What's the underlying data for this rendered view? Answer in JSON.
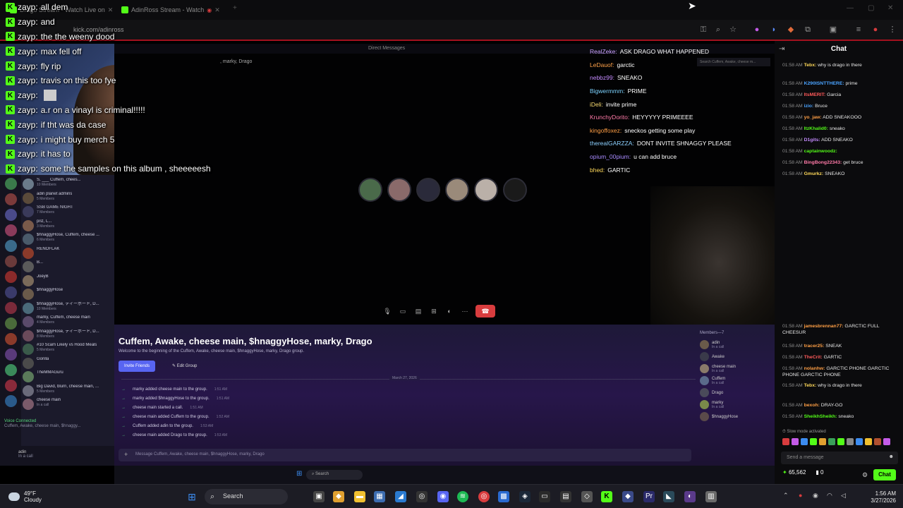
{
  "browser": {
    "tabs": [
      {
        "label": "Drago Stream - Watch Live on"
      },
      {
        "label": "AdinRoss Stream - Watch"
      }
    ],
    "url": "kick.com/adinross"
  },
  "overlay_chat": [
    {
      "user": "zayp:",
      "text": "all dem"
    },
    {
      "user": "zayp:",
      "text": "and"
    },
    {
      "user": "zayp:",
      "text": "the the weeny dood"
    },
    {
      "user": "zayp:",
      "text": "max fell off"
    },
    {
      "user": "zayp:",
      "text": "fly rip"
    },
    {
      "user": "zayp:",
      "text": "travis on this too fye"
    },
    {
      "user": "zayp:",
      "text": ""
    },
    {
      "user": "zayp:",
      "text": "a.r on a vinayl is criminal!!!!!"
    },
    {
      "user": "zayp:",
      "text": "if tht was da case"
    },
    {
      "user": "zayp:",
      "text": "i might buy merch 5"
    },
    {
      "user": "zayp:",
      "text": "it has to"
    },
    {
      "user": "zayp:",
      "text": "some the samples on this album , sheeeeesh"
    }
  ],
  "discord": {
    "topbar": "Direct Messages",
    "call_title": ", marky, Drago",
    "search_placeholder": "Search Cuffem, Awake, cheese m...",
    "dm_list": [
      {
        "name": "S, ___ Cuffem, chees...",
        "sub": "10 Members"
      },
      {
        "name": "adin planet admins",
        "sub": "5 Members"
      },
      {
        "name": "SSB GAME NIGHT",
        "sub": "7 Members"
      },
      {
        "name": "priz, L...",
        "sub": "3 Members"
      },
      {
        "name": "$hnaggyHose, Cuffem, cheese ...",
        "sub": "6 Members"
      },
      {
        "name": "RENOFLAK",
        "sub": ""
      },
      {
        "name": "B...",
        "sub": ""
      },
      {
        "name": "JoeyB",
        "sub": ""
      },
      {
        "name": "$hnaggyHose",
        "sub": ""
      },
      {
        "name": "$hnaggyHose, ディーボード, D...",
        "sub": "10 Members"
      },
      {
        "name": "marky, Cuffem, cheese main",
        "sub": "4 Members"
      },
      {
        "name": "$hnaggyHose, ディーボード, D...",
        "sub": "8 Members"
      },
      {
        "name": "#10 Scam Likely vs Hood Meals",
        "sub": "5 Members"
      },
      {
        "name": "Gorilla",
        "sub": ""
      },
      {
        "name": "TheMMAGuru",
        "sub": ""
      },
      {
        "name": "Big David, blurri, cheese main, ...",
        "sub": "5 Members"
      },
      {
        "name": "cheese main",
        "sub": "In a call"
      }
    ],
    "voice_status": "Voice Connected",
    "voice_channel": "Cuffem, Awake, cheese main, $hnaggy...",
    "user_name": "adin",
    "user_status": "In a call",
    "group_title": "Cuffem, Awake, cheese main, $hnaggyHose, marky, Drago",
    "group_sub": "Welcome to the beginning of the Cuffem, Awake, cheese main, $hnaggyHose, marky, Drago group.",
    "invite_btn": "Invite Friends",
    "edit_btn": "Edit Group",
    "date_divider": "March 27, 2026",
    "system_messages": [
      {
        "text": "marky added cheese main to the group.",
        "ts": "1:51 AM"
      },
      {
        "text": "marky added $hnaggyHose to the group.",
        "ts": "1:51 AM"
      },
      {
        "text": "cheese main started a call.",
        "ts": "1:51 AM"
      },
      {
        "text": "cheese main added Cuffem to the group.",
        "ts": "1:52 AM"
      },
      {
        "text": "Cuffem added adin to the group.",
        "ts": "1:53 AM"
      },
      {
        "text": "cheese main added Drago to the group.",
        "ts": "1:53 AM"
      }
    ],
    "members_header": "Members—7",
    "members": [
      {
        "name": "adin",
        "sub": "In a call"
      },
      {
        "name": "Awake",
        "sub": ""
      },
      {
        "name": "cheese main",
        "sub": "In a call"
      },
      {
        "name": "Cuffem",
        "sub": "In a call"
      },
      {
        "name": "Drago",
        "sub": ""
      },
      {
        "name": "marky",
        "sub": "In a call"
      },
      {
        "name": "$hnaggyHose",
        "sub": ""
      }
    ],
    "message_placeholder": "Message Cuffem, Awake, cheese main, $hnaggyHose, marky, Drago"
  },
  "game_chat": [
    {
      "user": "RealZeke:",
      "text": "ASK DRAGO WHAT HAPPENED",
      "color": "#c9a0ff"
    },
    {
      "user": "LeDauof:",
      "text": "garctic",
      "color": "#ffa24a"
    },
    {
      "user": "nebbz99:",
      "text": "SNEAKO",
      "color": "#c58bff"
    },
    {
      "user": "Bigwermmm:",
      "text": "PRIME",
      "color": "#7dd3ff"
    },
    {
      "user": "iDeli:",
      "text": "invite prime",
      "color": "#f5d76e"
    },
    {
      "user": "KrunchyDorito:",
      "text": "HEYYYYY PRIMEEEE",
      "color": "#ff7aa8"
    },
    {
      "user": "kingoffoxez:",
      "text": "sneckos getting some play",
      "color": "#ff9f45"
    },
    {
      "user": "therealGARZZA:",
      "text": "DONT INVITE SHNAGGY PLEASE",
      "color": "#8cd0ff"
    },
    {
      "user": "opium_00pium:",
      "text": "u can add bruce",
      "color": "#a88bff"
    },
    {
      "user": "bhed:",
      "text": "GARTIC",
      "color": "#ffd95a"
    }
  ],
  "kick_chat": {
    "title": "Chat",
    "messages": [
      {
        "time": "01:58 AM",
        "user": "Tebx:",
        "text": "why is drago in there",
        "color": "#ffd95a"
      },
      {
        "time": "01:58 AM",
        "user": "K290ISNTTHERE:",
        "text": "prime",
        "color": "#4aa3ff"
      },
      {
        "time": "01:58 AM",
        "user": "ItsMERIT:",
        "text": "Garcia",
        "color": "#ff5a5a"
      },
      {
        "time": "01:58 AM",
        "user": "izio:",
        "text": "Bruce",
        "color": "#4aa3ff"
      },
      {
        "time": "01:58 AM",
        "user": "yo_jaw:",
        "text": "ADD SNEAKOOO",
        "color": "#ff9f45"
      },
      {
        "time": "01:58 AM",
        "user": "ItzKhalid0:",
        "text": "sneako",
        "color": "#53fc18"
      },
      {
        "time": "01:58 AM",
        "user": "D1gits:",
        "text": "ADD SNEAKO",
        "color": "#c58bff"
      },
      {
        "time": "01:58 AM",
        "user": "captainwoodz:",
        "text": "",
        "color": "#53fc18"
      },
      {
        "time": "01:58 AM",
        "user": "BingBong22343:",
        "text": "get bruce",
        "color": "#ff7aa8"
      },
      {
        "time": "01:58 AM",
        "user": "Gmurkz:",
        "text": "SNEAKO",
        "color": "#ffd95a"
      },
      {
        "time": "01:58 AM",
        "user": "jamesbrennan77:",
        "text": "GARCTIC FULL CHEESUR",
        "color": "#ff9f45"
      },
      {
        "time": "01:58 AM",
        "user": "tracer25:",
        "text": "SNEAK",
        "color": "#ff9f45"
      },
      {
        "time": "01:58 AM",
        "user": "TheCrit:",
        "text": "GARTIC",
        "color": "#ff5a5a"
      },
      {
        "time": "01:58 AM",
        "user": "nolanhw:",
        "text": "GARCTIC PHONE GARCTIC PHONE GARCTIC PHONE",
        "color": "#ff9f45"
      },
      {
        "time": "01:58 AM",
        "user": "Tebx:",
        "text": "why is drago in there",
        "color": "#ffd95a"
      },
      {
        "time": "01:58 AM",
        "user": "bexoh:",
        "text": "DRAY-GO",
        "color": "#ff9f45"
      },
      {
        "time": "01:58 AM",
        "user": "SheikhSheikh:",
        "text": "sneako",
        "color": "#53fc18"
      }
    ],
    "slow_mode": "Slow mode activated",
    "input_placeholder": "Send a message",
    "points": "65,562",
    "zero": "0",
    "chat_btn": "Chat"
  },
  "taskbar": {
    "temp": "49°F",
    "weather": "Cloudy",
    "search": "Search",
    "time": "1:56 AM",
    "date": "3/27/2026"
  },
  "inner_taskbar": {
    "search": "Search"
  }
}
